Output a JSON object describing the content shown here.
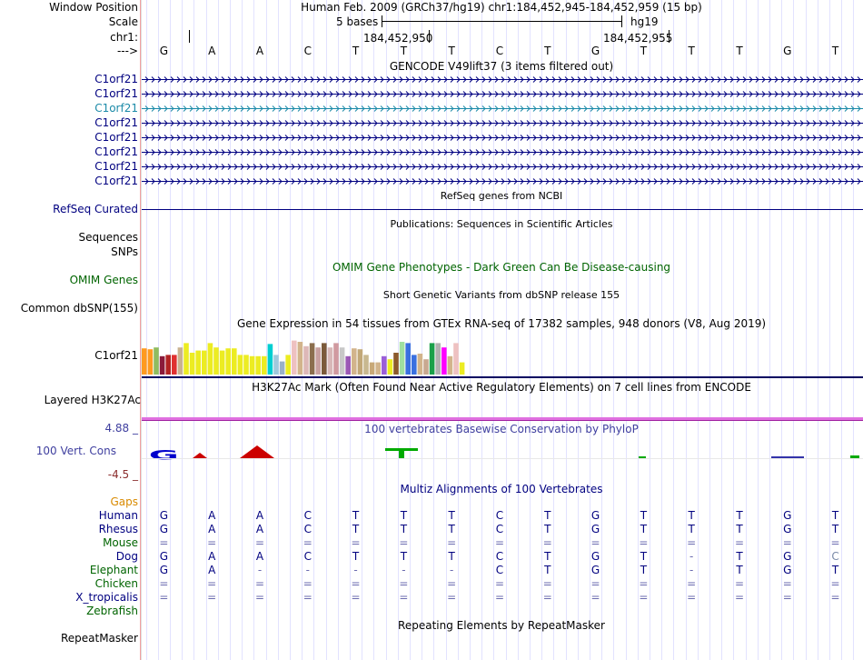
{
  "header": {
    "window_position_label": "Window Position",
    "scale_label": "Scale",
    "chrom_label": "chr1:",
    "arrow_label": "--->",
    "position_text": "Human Feb. 2009 (GRCh37/hg19)   chr1:184,452,945-184,452,959 (15 bp)",
    "scale_text": "5 bases",
    "assembly": "hg19",
    "tick1": "184,452,950",
    "tick2": "184,452,955"
  },
  "reference_bases": [
    "G",
    "A",
    "A",
    "C",
    "T",
    "T",
    "T",
    "C",
    "T",
    "G",
    "T",
    "T",
    "T",
    "G",
    "T"
  ],
  "gencode": {
    "title": "GENCODE V49lift37 (3 items filtered out)",
    "items": [
      {
        "label": "C1orf21",
        "highlight": false
      },
      {
        "label": "C1orf21",
        "highlight": false
      },
      {
        "label": "C1orf21",
        "highlight": true
      },
      {
        "label": "C1orf21",
        "highlight": false
      },
      {
        "label": "C1orf21",
        "highlight": false
      },
      {
        "label": "C1orf21",
        "highlight": false
      },
      {
        "label": "C1orf21",
        "highlight": false
      },
      {
        "label": "C1orf21",
        "highlight": false
      }
    ]
  },
  "refseq": {
    "title": "RefSeq genes from NCBI",
    "label": "RefSeq Curated"
  },
  "publications": {
    "title": "Publications: Sequences in Scientific Articles",
    "label1": "Sequences",
    "label2": "SNPs"
  },
  "omim": {
    "title": "OMIM Gene Phenotypes - Dark Green Can Be Disease-causing",
    "label": "OMIM Genes"
  },
  "dbsnp": {
    "title": "Short Genetic Variants from dbSNP release 155",
    "label": "Common dbSNP(155)"
  },
  "gtex": {
    "title": "Gene Expression in 54 tissues from GTEx RNA-seq of 17382 samples, 948 donors (V8, Aug 2019)",
    "label": "C1orf21",
    "levels": [
      0.6,
      0.58,
      0.62,
      0.42,
      0.45,
      0.45,
      0.62,
      0.72,
      0.5,
      0.55,
      0.55,
      0.72,
      0.62,
      0.55,
      0.6,
      0.6,
      0.45,
      0.45,
      0.42,
      0.42,
      0.42,
      0.7,
      0.45,
      0.3,
      0.45,
      0.78,
      0.75,
      0.65,
      0.72,
      0.62,
      0.72,
      0.62,
      0.72,
      0.62,
      0.42,
      0.6,
      0.58,
      0.45,
      0.28,
      0.28,
      0.42,
      0.35,
      0.5,
      0.75,
      0.72,
      0.45,
      0.48,
      0.35,
      0.72,
      0.72,
      0.62,
      0.42,
      0.72,
      0.28
    ],
    "colors": [
      "#ff9a1f",
      "#ff9a1f",
      "#8fbc5f",
      "#8b1a3a",
      "#b22222",
      "#e03030",
      "#c9b290",
      "#ecec22",
      "#ecec22",
      "#ecec22",
      "#ecec22",
      "#ecec22",
      "#ecec22",
      "#ecec22",
      "#ecec22",
      "#ecec22",
      "#ecec22",
      "#ecec22",
      "#ecec22",
      "#ecec22",
      "#ecec22",
      "#00ced1",
      "#a0c8dc",
      "#9ab0c8",
      "#ecec22",
      "#eec1c1",
      "#d2b48c",
      "#ddb8b8",
      "#8b6e4e",
      "#c8a0a0",
      "#7b5a3a",
      "#d8b8b8",
      "#d09aa0",
      "#c8c8c8",
      "#9b59b6",
      "#d2b48c",
      "#c2a878",
      "#c8b890",
      "#c8a878",
      "#d2b48c",
      "#9b5fd8",
      "#ecec22",
      "#8b5a2b",
      "#a0e0a0",
      "#3a70e0",
      "#3a70e0",
      "#d2b48c",
      "#c8a890",
      "#1aa04a",
      "#b0b0b0",
      "#ff00ff",
      "#d2b48c",
      "#eec1c1",
      "#ecec22"
    ]
  },
  "h3k27ac": {
    "title": "H3K27Ac Mark (Often Found Near Active Regulatory Elements) on 7 cell lines from ENCODE",
    "label": "Layered H3K27Ac"
  },
  "phylop": {
    "title": "100 vertebrates Basewise Conservation by PhyloP",
    "label": "100 Vert. Cons",
    "max": "4.88 _",
    "min": "-4.5 _"
  },
  "multiz": {
    "title": "Multiz Alignments of 100 Vertebrates",
    "gaps_label": "Gaps",
    "species": [
      {
        "name": "Human",
        "color": "navy",
        "bases": [
          "G",
          "A",
          "A",
          "C",
          "T",
          "T",
          "T",
          "C",
          "T",
          "G",
          "T",
          "T",
          "T",
          "G",
          "T"
        ]
      },
      {
        "name": "Rhesus",
        "color": "navy",
        "bases": [
          "G",
          "A",
          "A",
          "C",
          "T",
          "T",
          "T",
          "C",
          "T",
          "G",
          "T",
          "T",
          "T",
          "G",
          "T"
        ]
      },
      {
        "name": "Mouse",
        "color": "green",
        "bases": [
          "=",
          "=",
          "=",
          "=",
          "=",
          "=",
          "=",
          "=",
          "=",
          "=",
          "=",
          "=",
          "=",
          "=",
          "="
        ]
      },
      {
        "name": "Dog",
        "color": "navy",
        "bases": [
          "G",
          "A",
          "A",
          "C",
          "T",
          "T",
          "T",
          "C",
          "T",
          "G",
          "T",
          "-",
          "T",
          "G",
          "C"
        ]
      },
      {
        "name": "Elephant",
        "color": "green",
        "bases": [
          "G",
          "A",
          "-",
          "-",
          "-",
          "-",
          "-",
          "C",
          "T",
          "G",
          "T",
          "-",
          "T",
          "G",
          "T"
        ]
      },
      {
        "name": "Chicken",
        "color": "green",
        "bases": [
          "=",
          "=",
          "=",
          "=",
          "=",
          "=",
          "=",
          "=",
          "=",
          "=",
          "=",
          "=",
          "=",
          "=",
          "="
        ]
      },
      {
        "name": "X_tropicalis",
        "color": "navy",
        "bases": [
          "=",
          "=",
          "=",
          "=",
          "=",
          "=",
          "=",
          "=",
          "=",
          "=",
          "=",
          "=",
          "=",
          "=",
          "="
        ]
      },
      {
        "name": "Zebrafish",
        "color": "green",
        "bases": [
          "",
          "",
          "",
          "",
          "",
          "",
          "",
          "",
          "",
          "",
          "",
          "",
          "",
          "",
          ""
        ]
      }
    ]
  },
  "repeatmasker": {
    "title": "Repeating Elements by RepeatMasker",
    "label": "RepeatMasker"
  },
  "colors": {
    "navy": "#000080",
    "green": "#006400",
    "gaps": "#d98a00",
    "separator": "#f0a0a0",
    "grid": "#ccccff"
  }
}
